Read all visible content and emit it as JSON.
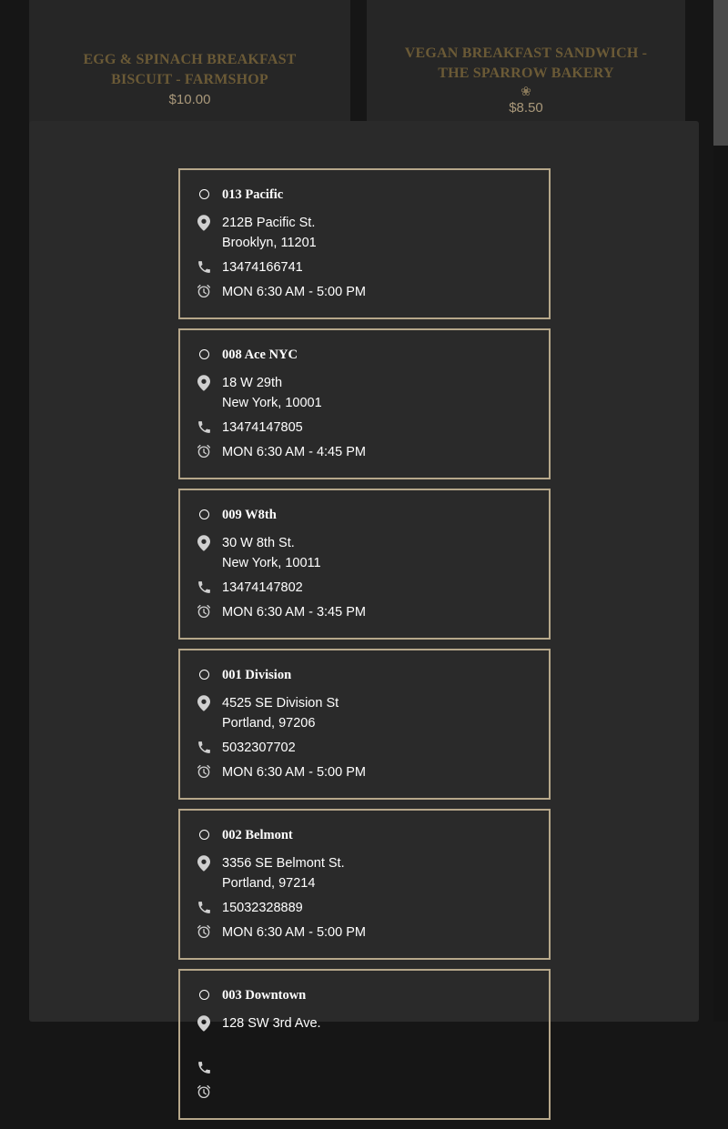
{
  "background_products": [
    {
      "title": "EGG & SPINACH BREAKFAST BISCUIT - FARMSHOP",
      "price": "$10.00"
    },
    {
      "title": "VEGAN BREAKFAST SANDWICH - THE SPARROW BAKERY",
      "price": "$8.50",
      "badge_icon": "vegan-leaf-icon"
    }
  ],
  "colors": {
    "accent_border": "#b6a78a",
    "modal_bg": "#2a2a2a",
    "page_bg": "#161616",
    "text": "#ffffff"
  },
  "icons": {
    "radio": "radio-unselected-icon",
    "address": "map-pin-icon",
    "phone": "phone-icon",
    "hours": "alarm-clock-icon"
  },
  "stores": [
    {
      "name": "013 Pacific",
      "address_line1": "212B Pacific St.",
      "address_line2": "Brooklyn, 11201",
      "phone": "13474166741",
      "hours": "MON 6:30 AM - 5:00 PM"
    },
    {
      "name": "008 Ace NYC",
      "address_line1": "18 W 29th",
      "address_line2": "New York, 10001",
      "phone": "13474147805",
      "hours": "MON 6:30 AM - 4:45 PM"
    },
    {
      "name": "009 W8th",
      "address_line1": "30 W 8th St.",
      "address_line2": "New York, 10011",
      "phone": "13474147802",
      "hours": "MON 6:30 AM - 3:45 PM"
    },
    {
      "name": "001 Division",
      "address_line1": "4525 SE Division St",
      "address_line2": "Portland, 97206",
      "phone": "5032307702",
      "hours": "MON 6:30 AM - 5:00 PM"
    },
    {
      "name": "002 Belmont",
      "address_line1": "3356 SE Belmont St.",
      "address_line2": "Portland, 97214",
      "phone": "15032328889",
      "hours": "MON 6:30 AM - 5:00 PM"
    },
    {
      "name": "003 Downtown",
      "address_line1": "128 SW 3rd Ave.",
      "address_line2": "",
      "phone": "",
      "hours": ""
    }
  ]
}
